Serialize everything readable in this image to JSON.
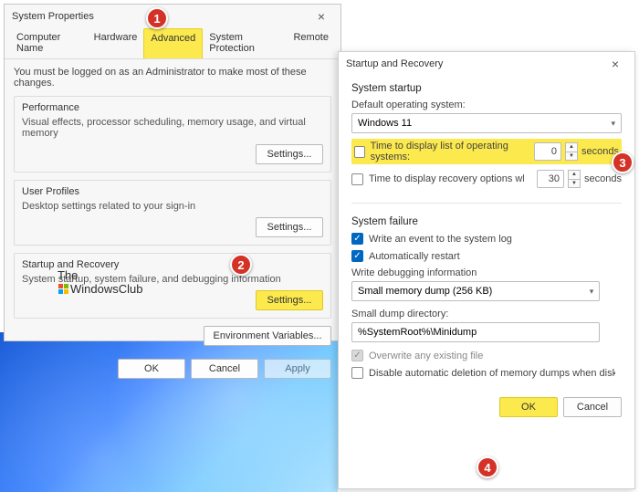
{
  "callouts": {
    "c1": "1",
    "c2": "2",
    "c3": "3",
    "c4": "4"
  },
  "sysprops": {
    "title": "System Properties",
    "tabs": {
      "computer_name": "Computer Name",
      "hardware": "Hardware",
      "advanced": "Advanced",
      "system_protection": "System Protection",
      "remote": "Remote"
    },
    "instruction": "You must be logged on as an Administrator to make most of these changes.",
    "performance": {
      "title": "Performance",
      "desc": "Visual effects, processor scheduling, memory usage, and virtual memory",
      "button": "Settings..."
    },
    "user_profiles": {
      "title": "User Profiles",
      "desc": "Desktop settings related to your sign-in",
      "button": "Settings..."
    },
    "startup_recovery": {
      "title": "Startup and Recovery",
      "desc": "System startup, system failure, and debugging information",
      "button": "Settings..."
    },
    "env_button": "Environment Variables...",
    "ok": "OK",
    "cancel": "Cancel",
    "apply": "Apply"
  },
  "brand": {
    "line1": "The",
    "line2": "WindowsClub"
  },
  "recovery": {
    "title": "Startup and Recovery",
    "system_startup_heading": "System startup",
    "default_os_label": "Default operating system:",
    "default_os_value": "Windows 11",
    "row_list_os": "Time to display list of operating systems:",
    "row_list_os_value": "0",
    "row_recovery": "Time to display recovery options when needed",
    "row_recovery_value": "30",
    "seconds": "seconds",
    "system_failure_heading": "System failure",
    "write_event": "Write an event to the system log",
    "auto_restart": "Automatically restart",
    "write_debug_label": "Write debugging information",
    "write_debug_value": "Small memory dump (256 KB)",
    "dump_dir_label": "Small dump directory:",
    "dump_dir_value": "%SystemRoot%\\Minidump",
    "overwrite": "Overwrite any existing file",
    "disable_delete": "Disable automatic deletion of memory dumps when disk space is low",
    "ok": "OK",
    "cancel": "Cancel"
  }
}
